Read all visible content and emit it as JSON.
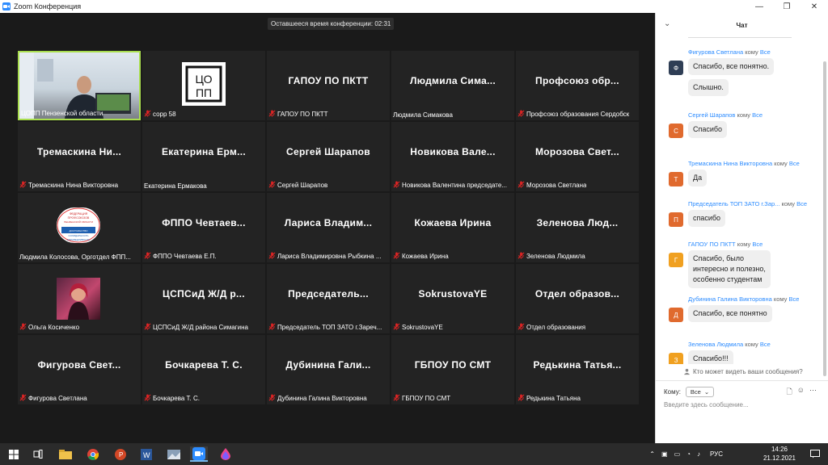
{
  "window": {
    "title": "Zoom Конференция"
  },
  "timer": "Оставшееся время конференции: 02:31",
  "tiles": [
    {
      "big": "",
      "label": "ЦОПП Пензенской области",
      "muted": false,
      "active": true,
      "kind": "photo"
    },
    {
      "big": "",
      "label": "сорр 58",
      "muted": true,
      "kind": "logo"
    },
    {
      "big": "ГАПОУ ПО ПКТТ",
      "label": "ГАПОУ ПО ПКТТ",
      "muted": true
    },
    {
      "big": "Людмила Сима...",
      "label": "Людмила Симакова",
      "muted": false
    },
    {
      "big": "Профсоюз обр...",
      "label": "Профсоюз образования Сердобск",
      "muted": true
    },
    {
      "big": "Тремаскина Ни...",
      "label": "Тремаскина Нина Викторовна",
      "muted": true
    },
    {
      "big": "Екатерина Ерм...",
      "label": "Екатерина Ермакова",
      "muted": false
    },
    {
      "big": "Сергей Шарапов",
      "label": "Сергей Шарапов",
      "muted": true
    },
    {
      "big": "Новикова Вале...",
      "label": "Новикова Валентина председате...",
      "muted": true
    },
    {
      "big": "Морозова Свет...",
      "label": "Морозова Светлана",
      "muted": true
    },
    {
      "big": "",
      "label": "Людмила Колосова, Орготдел ФПП...",
      "muted": false,
      "kind": "badge"
    },
    {
      "big": "ФППО Чевтаев...",
      "label": "ФППО Чевтаева Е.П.",
      "muted": true
    },
    {
      "big": "Лариса Владим...",
      "label": "Лариса Владимировна Рыбкина ...",
      "muted": true
    },
    {
      "big": "Кожаева Ирина",
      "label": "Кожаева Ирина",
      "muted": true
    },
    {
      "big": "Зеленова Люд...",
      "label": "Зеленова Людмила",
      "muted": true
    },
    {
      "big": "",
      "label": "Ольга Косиченко",
      "muted": true,
      "kind": "avatar"
    },
    {
      "big": "ЦСПСиД Ж/Д р...",
      "label": "ЦСПСиД Ж/Д района Симагина",
      "muted": true
    },
    {
      "big": "Председатель...",
      "label": "Председатель ТОП ЗАТО г.Зареч...",
      "muted": true
    },
    {
      "big": "SokrustovaYE",
      "label": "SokrustovaYE",
      "muted": true
    },
    {
      "big": "Отдел образов...",
      "label": "Отдел образования",
      "muted": true
    },
    {
      "big": "Фигурова Свет...",
      "label": "Фигурова Светлана",
      "muted": true
    },
    {
      "big": "Бочкарева Т. С.",
      "label": "Бочкарева Т. С.",
      "muted": true
    },
    {
      "big": "Дубинина Гали...",
      "label": "Дубинина Галина Викторовна",
      "muted": true
    },
    {
      "big": "ГБПОУ ПО СМТ",
      "label": "ГБПОУ ПО СМТ",
      "muted": true
    },
    {
      "big": "Редькина Татья...",
      "label": "Редькина Татьяна",
      "muted": true
    }
  ],
  "logo_text": [
    "ЦО",
    "ПП"
  ],
  "badge_text": [
    "ФЕДЕРАЦИЯ",
    "ПРОФСОЮЗОВ",
    "ПЕНЗЕНСКОЙ ОБЛАСТИ",
    "ДОСТОИНСТВО",
    "СОЛИДАРНОСТЬ",
    "СПРАВЕДЛИВОСТЬ"
  ],
  "chat": {
    "title": "Чат",
    "to_word": "кому",
    "messages": [
      {
        "sender": "Фигурова Светлана",
        "to": "Все",
        "initial": "Ф",
        "color": "#2f3e55",
        "lines": [
          "Спасибо, все понятно.",
          "Слышно."
        ]
      },
      {
        "sender": "Сергей Шарапов",
        "to": "Все",
        "initial": "С",
        "color": "#e06a2e",
        "lines": [
          "Спасибо"
        ]
      },
      {
        "sender": "Тремаскина Нина Викторовна",
        "to": "Все",
        "initial": "Т",
        "color": "#e06a2e",
        "lines": [
          "Да"
        ]
      },
      {
        "sender": "Председатель ТОП ЗАТО г.Зар...",
        "to": "Все",
        "initial": "П",
        "color": "#e06a2e",
        "lines": [
          "спасибо"
        ]
      },
      {
        "sender": "ГАПОУ ПО ПКТТ",
        "to": "Все",
        "initial": "Г",
        "color": "#f0a020",
        "lines": [
          "Спасибо, было интересно и полезно, особенно студентам"
        ]
      },
      {
        "sender": "Дубинина Галина Викторовна",
        "to": "Все",
        "initial": "Д",
        "color": "#e06a2e",
        "lines": [
          "Спасибо, все понятно"
        ]
      },
      {
        "sender": "Зеленова Людмила",
        "to": "Все",
        "initial": "З",
        "color": "#f0a020",
        "lines": [
          "Спасибо!!!"
        ]
      }
    ],
    "ganpou_lines": [
      "Спасибо, было",
      "интересно и полезно,",
      "особенно студентам"
    ],
    "who_sees": "Кто может видеть ваши сообщения?",
    "to_label": "Кому:",
    "to_value": "Все",
    "input_placeholder": "Введите здесь сообщение..."
  },
  "taskbar": {
    "lang": "РУС",
    "time": "14:26",
    "date": "21.12.2021"
  }
}
